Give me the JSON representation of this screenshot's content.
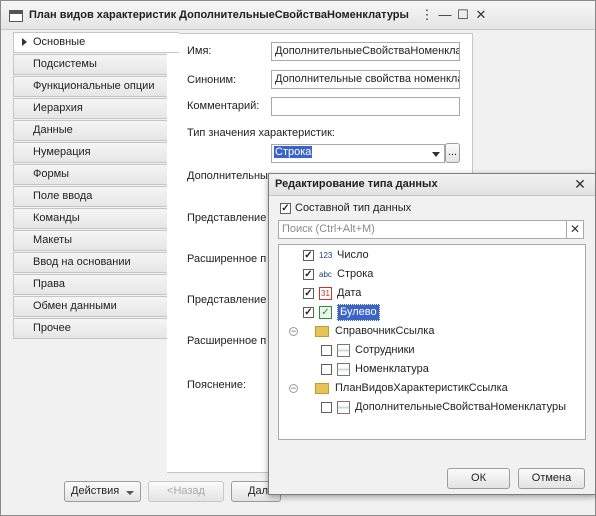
{
  "window": {
    "title": "План видов характеристик ДополнительныеСвойстваНоменклатуры",
    "tabs": [
      "Основные",
      "Подсистемы",
      "Функциональные опции",
      "Иерархия",
      "Данные",
      "Нумерация",
      "Формы",
      "Поле ввода",
      "Команды",
      "Макеты",
      "Ввод на основании",
      "Права",
      "Обмен данными",
      "Прочее"
    ],
    "active_tab": "Основные"
  },
  "form": {
    "name_label": "Имя:",
    "name_value": "ДополнительныеСвойстваНоменклатуры",
    "synonym_label": "Синоним:",
    "synonym_value": "Дополнительные свойства номенклатуры",
    "comment_label": "Комментарий:",
    "comment_value": "",
    "type_label": "Тип значения характеристик:",
    "type_value": "Строка",
    "ellipsis": "...",
    "additional_label": "Дополнительны",
    "presentation1_label": "Представление",
    "extended1_label": "Расширенное п",
    "presentation2_label": "Представление",
    "extended2_label": "Расширенное п",
    "note_label": "Пояснение:"
  },
  "bottom_bar": {
    "actions_label": "Действия",
    "back_label": "<Назад",
    "next_label": "Дал"
  },
  "dialog": {
    "title": "Редактирование типа данных",
    "composite_label": "Составной тип данных",
    "composite_checked": true,
    "search_placeholder": "Поиск (Ctrl+Alt+M)",
    "items": [
      {
        "label": "Число",
        "checked": true,
        "icon": "number-type-icon",
        "icon_text": "123"
      },
      {
        "label": "Строка",
        "checked": true,
        "icon": "string-type-icon",
        "icon_text": "abc"
      },
      {
        "label": "Дата",
        "checked": true,
        "icon": "calendar-icon",
        "icon_text": "31"
      },
      {
        "label": "Булево",
        "checked": true,
        "icon": "boolean-icon",
        "icon_text": "✓",
        "selected": true
      }
    ],
    "group1": {
      "label": "СправочникСсылка",
      "children": [
        "Сотрудники",
        "Номенклатура"
      ]
    },
    "group2": {
      "label": "ПланВидовХарактеристикСсылка",
      "children": [
        "ДополнительныеСвойстваНоменклатуры"
      ]
    },
    "ok_label": "ОК",
    "cancel_label": "Отмена"
  },
  "colors": {
    "selection": "#3b64c6",
    "folder": "#e5c25a"
  }
}
